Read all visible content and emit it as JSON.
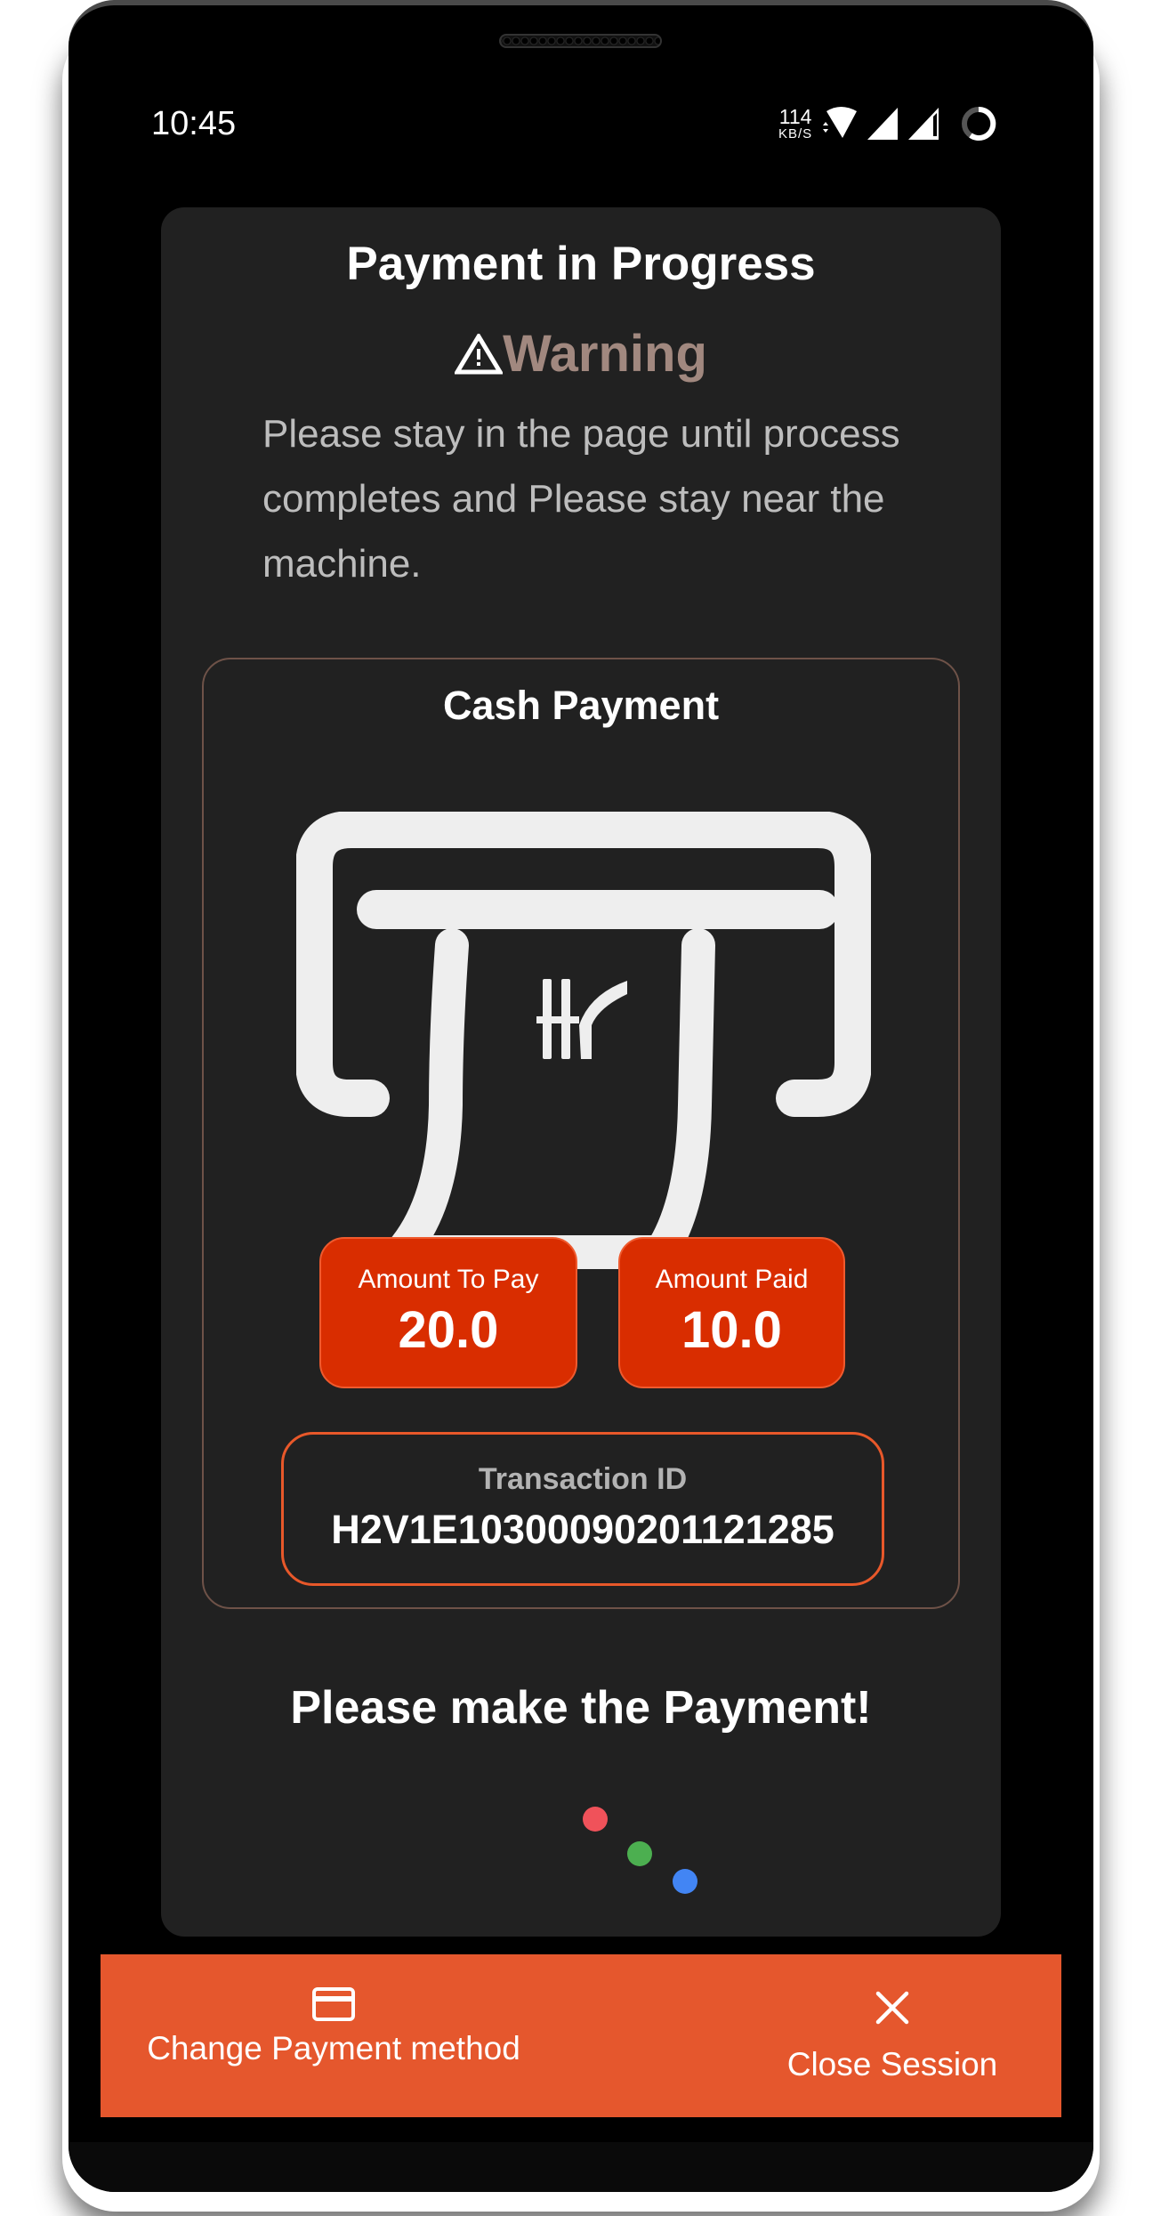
{
  "status_bar": {
    "time": "10:45",
    "network_speed_value": "114",
    "network_speed_unit": "KB/S",
    "icons": [
      "wifi-icon",
      "signal-full-icon",
      "signal-partial-icon",
      "battery-ring-icon"
    ]
  },
  "card": {
    "title": "Payment in Progress",
    "warning_label": "Warning",
    "warning_message": "Please stay in the page until process completes and Please stay near the machine."
  },
  "cash_payment": {
    "title": "Cash Payment",
    "icon": "cash-dispenser-icon",
    "amount_to_pay": {
      "label": "Amount To Pay",
      "value": "20.0"
    },
    "amount_paid": {
      "label": "Amount Paid",
      "value": "10.0"
    },
    "transaction": {
      "label": "Transaction ID",
      "value": "H2V1E10300090201121285"
    }
  },
  "prompt": "Please make the Payment!",
  "loader_colors": [
    "#f0525a",
    "#4caf50",
    "#4285f4"
  ],
  "bottom_bar": {
    "change_payment_label": "Change Payment method",
    "close_session_label": "Close Session"
  },
  "colors": {
    "accent": "#e5572d",
    "amount_box": "#d92d00",
    "warning_text": "#a1887f",
    "card_bg": "#212121"
  }
}
